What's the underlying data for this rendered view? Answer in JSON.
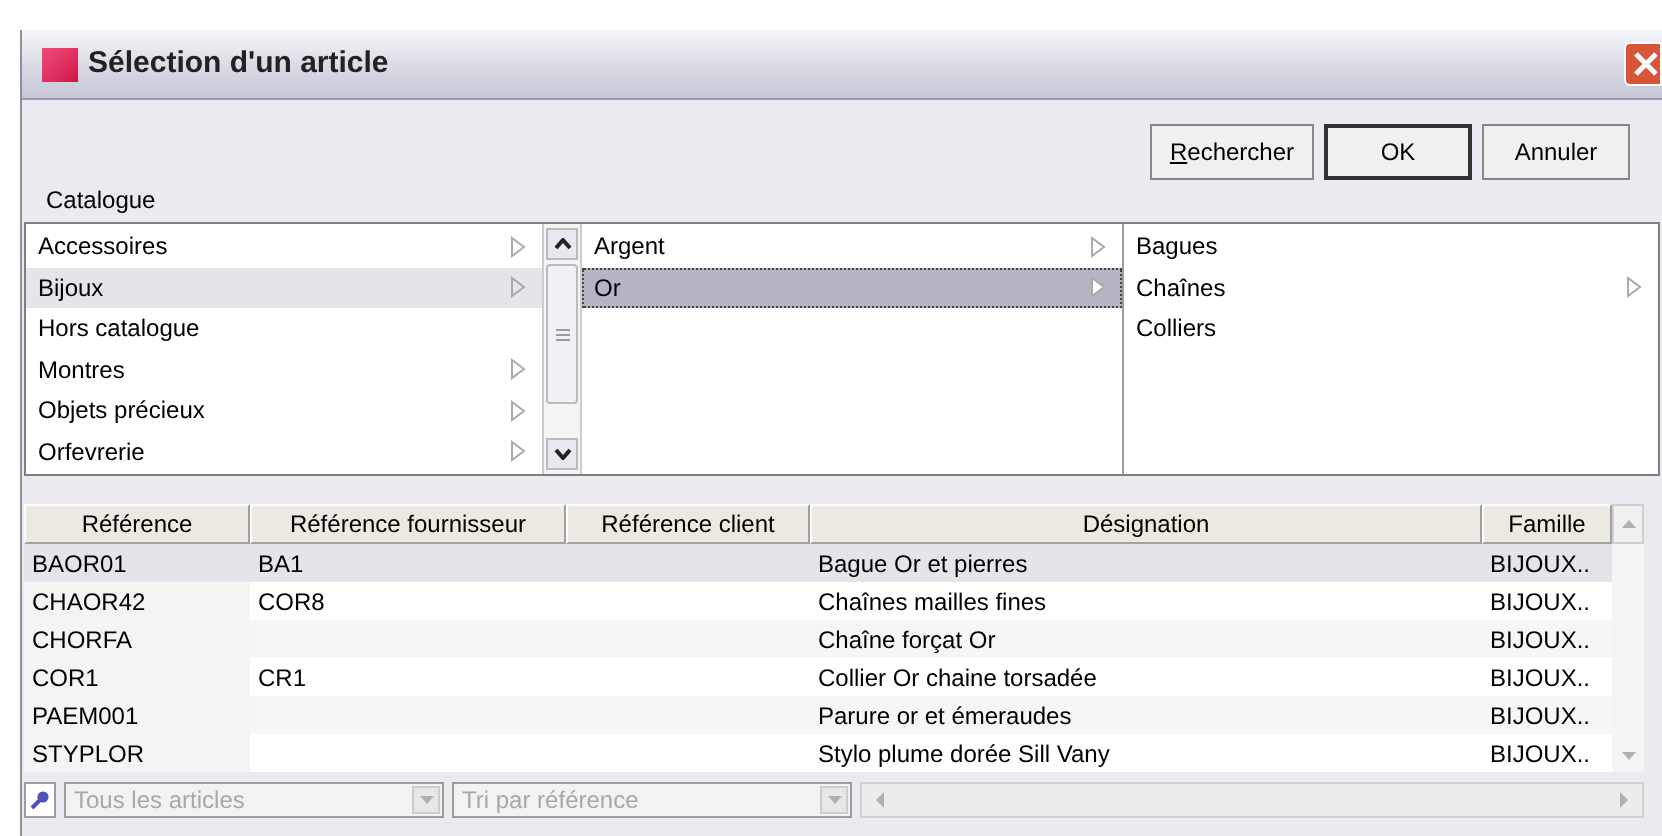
{
  "window": {
    "title": "Sélection d'un article"
  },
  "buttons": [
    {
      "label": "Rechercher",
      "mnemonic": true,
      "default": false
    },
    {
      "label": "OK",
      "mnemonic": false,
      "default": true
    },
    {
      "label": "Annuler",
      "mnemonic": false,
      "default": false
    }
  ],
  "catalogue": {
    "label": "Catalogue",
    "lists": [
      {
        "items": [
          {
            "label": "Accessoires",
            "has_children": true,
            "selected": false,
            "focused": false
          },
          {
            "label": "Bijoux",
            "has_children": true,
            "selected": true,
            "focused": false
          },
          {
            "label": "Hors catalogue",
            "has_children": false,
            "selected": false,
            "focused": false
          },
          {
            "label": "Montres",
            "has_children": true,
            "selected": false,
            "focused": false
          },
          {
            "label": "Objets précieux",
            "has_children": true,
            "selected": false,
            "focused": false
          },
          {
            "label": "Orfevrerie",
            "has_children": true,
            "selected": false,
            "focused": false
          }
        ],
        "scrollbar": true
      },
      {
        "items": [
          {
            "label": "Argent",
            "has_children": true,
            "selected": false,
            "focused": false
          },
          {
            "label": "Or",
            "has_children": true,
            "selected": true,
            "focused": true
          }
        ],
        "scrollbar": false
      },
      {
        "items": [
          {
            "label": "Bagues",
            "has_children": false,
            "selected": false,
            "focused": false
          },
          {
            "label": "Chaînes",
            "has_children": true,
            "selected": false,
            "focused": false
          },
          {
            "label": "Colliers",
            "has_children": false,
            "selected": false,
            "focused": false
          }
        ],
        "scrollbar": false
      }
    ]
  },
  "table": {
    "columns": [
      "Référence",
      "Référence fournisseur",
      "Référence client",
      "Désignation",
      "Famille"
    ],
    "rows": [
      {
        "cells": [
          "BAOR01",
          "BA1",
          "",
          "Bague Or et pierres",
          "BIJOUX.."
        ],
        "selected": true
      },
      {
        "cells": [
          "CHAOR42",
          "COR8",
          "",
          "Chaînes mailles fines",
          "BIJOUX.."
        ],
        "selected": false
      },
      {
        "cells": [
          "CHORFA",
          "",
          "",
          "Chaîne forçat Or",
          "BIJOUX.."
        ],
        "selected": false
      },
      {
        "cells": [
          "COR1",
          "CR1",
          "",
          "Collier Or chaine torsadée",
          "BIJOUX.."
        ],
        "selected": false
      },
      {
        "cells": [
          "PAEM001",
          "",
          "",
          "Parure or et émeraudes",
          "BIJOUX.."
        ],
        "selected": false
      },
      {
        "cells": [
          "STYPLOR",
          "",
          "",
          "Stylo plume dorée Sill Vany",
          "BIJOUX.."
        ],
        "selected": false
      }
    ]
  },
  "footer": {
    "filter": {
      "value": "Tous les articles",
      "disabled": true
    },
    "sort": {
      "value": "Tri par référence",
      "disabled": true
    }
  }
}
